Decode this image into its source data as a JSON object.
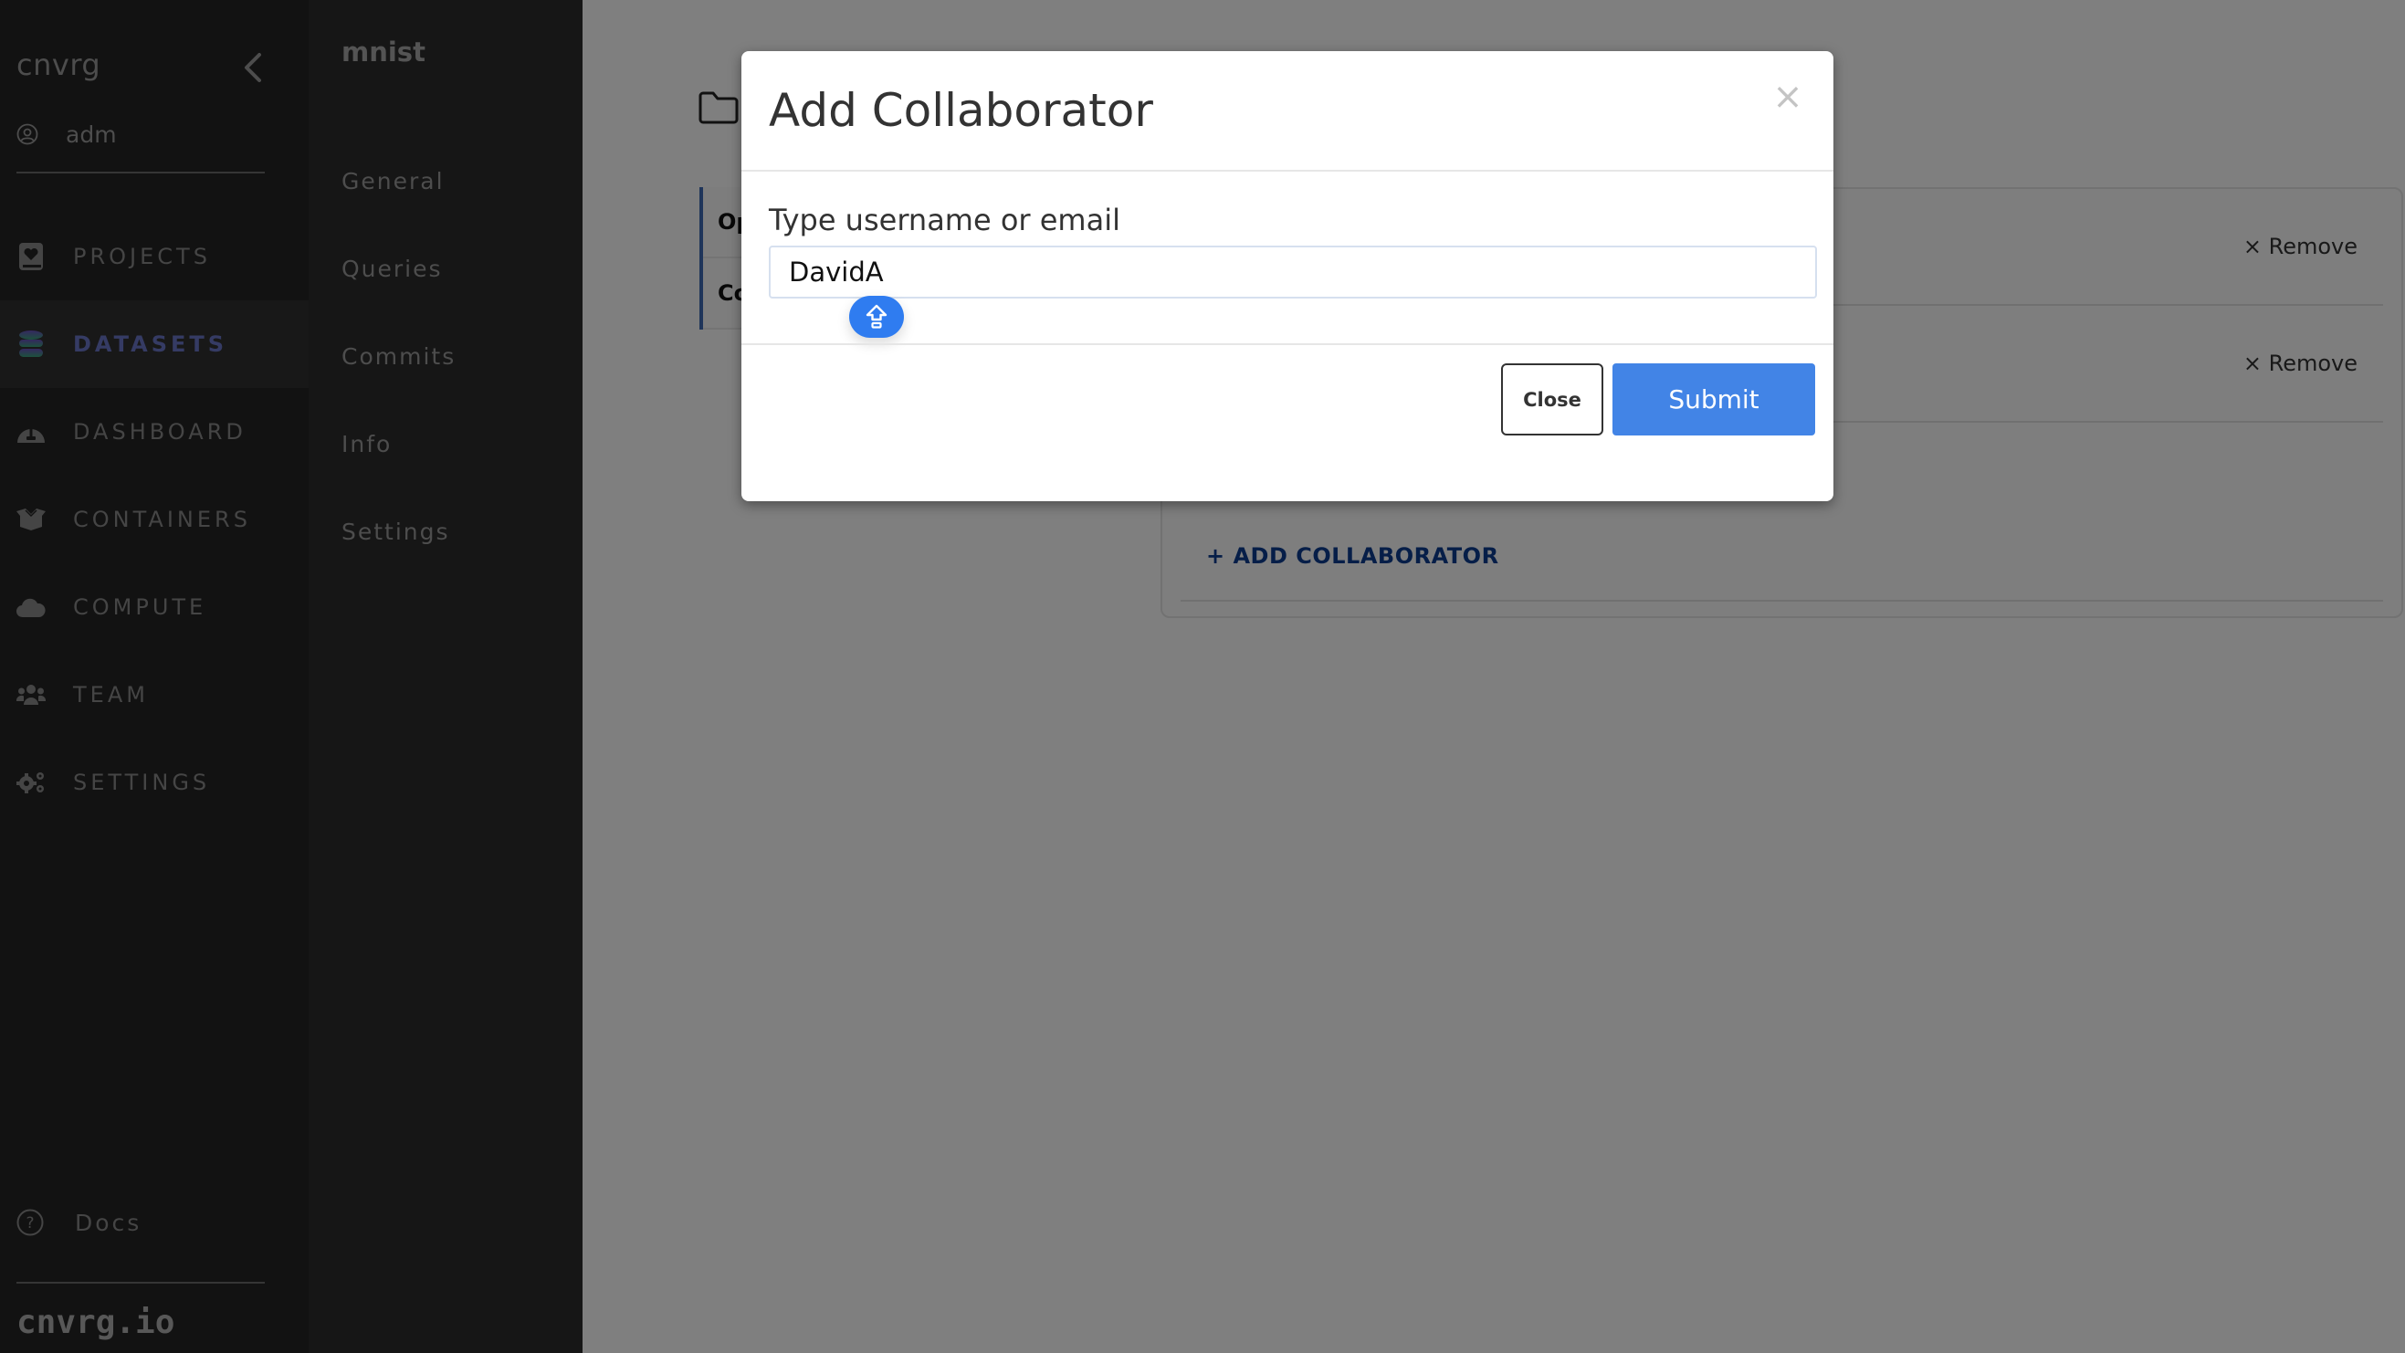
{
  "sidebar": {
    "brand": "cnvrg",
    "user": "adm",
    "nav_items": [
      {
        "label": "PROJECTS",
        "icon": "book-heart-icon"
      },
      {
        "label": "DATASETS",
        "icon": "database-icon",
        "active": true
      },
      {
        "label": "DASHBOARD",
        "icon": "dashboard-gauge-icon"
      },
      {
        "label": "CONTAINERS",
        "icon": "box-open-icon"
      },
      {
        "label": "COMPUTE",
        "icon": "cloud-icon"
      },
      {
        "label": "TEAM",
        "icon": "users-icon"
      },
      {
        "label": "SETTINGS",
        "icon": "gears-icon"
      }
    ],
    "docs_label": "Docs",
    "footer_brand": "cnvrg.io"
  },
  "subnav": {
    "title": "mnist",
    "items": [
      "General",
      "Queries",
      "Commits",
      "Info",
      "Settings"
    ]
  },
  "main": {
    "tabs": [
      "Op",
      "Co"
    ],
    "collaborators": [
      {
        "remove_label": "× Remove"
      },
      {
        "remove_label": "× Remove"
      }
    ],
    "add_collaborator_label": "+ ADD COLLABORATOR"
  },
  "modal": {
    "title": "Add Collaborator",
    "close_glyph": "×",
    "field_label": "Type username or email",
    "field_value": "DavidA",
    "close_button": "Close",
    "submit_button": "Submit"
  },
  "colors": {
    "accent": "#4284e6",
    "active_nav": "#6b77c8",
    "link": "#0d3d91"
  }
}
